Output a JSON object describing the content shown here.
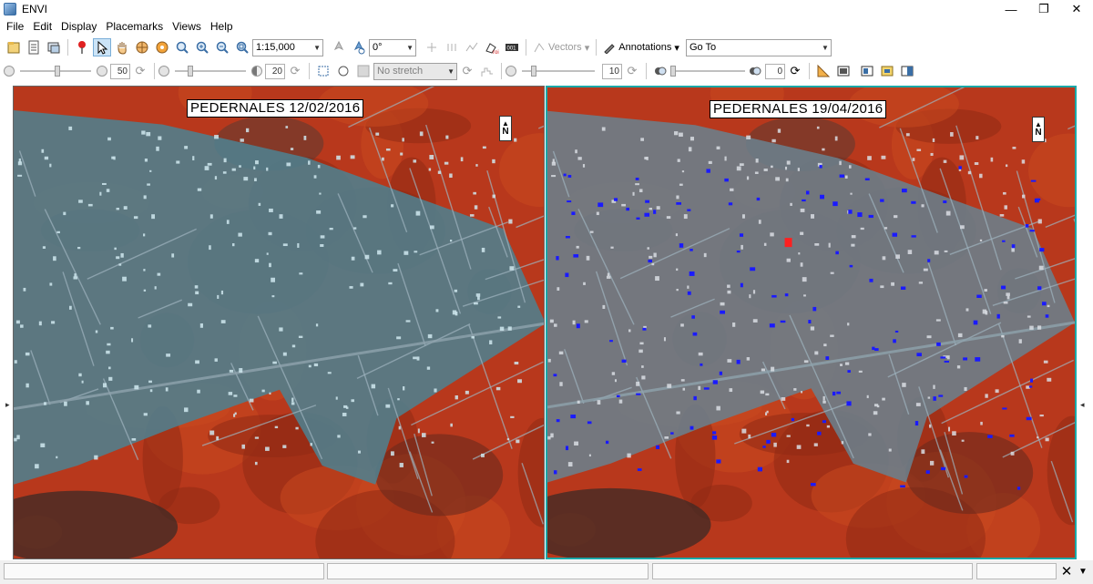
{
  "window": {
    "title": "ENVI",
    "minimize": "—",
    "restore": "❐",
    "close": "✕"
  },
  "menu": [
    "File",
    "Edit",
    "Display",
    "Placemarks",
    "Views",
    "Help"
  ],
  "toolbar1": {
    "scale_value": "1:15,000",
    "rotation_value": "0°",
    "vectors_label": "Vectors",
    "annotations_label": "Annotations",
    "goto_value": "Go To"
  },
  "toolbar2": {
    "brightness_value": "50",
    "contrast_value": "20",
    "stretch_value": "No stretch",
    "sharpen_value": "10",
    "transparency_value": "0"
  },
  "views": {
    "left_label": "PEDERNALES 12/02/2016",
    "right_label": "PEDERNALES 19/04/2016",
    "north_label": "N"
  },
  "status": {
    "close_glyph": "✕",
    "collapse_glyph": "▼"
  },
  "colors": {
    "vegetation": "#b8381c",
    "urban": "#4f7f8e",
    "active_view_border": "#1aa8a8",
    "change_marker": "#1a1aff"
  }
}
